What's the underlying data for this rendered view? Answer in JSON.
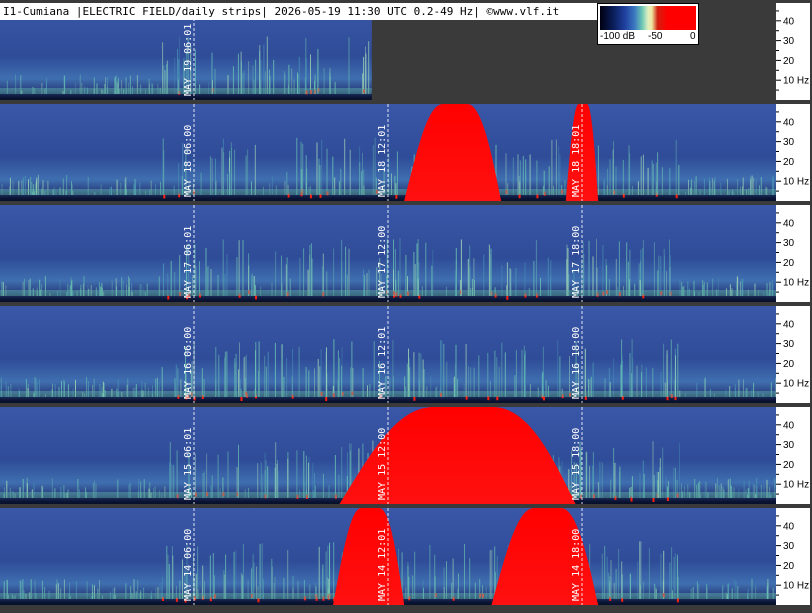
{
  "header": {
    "title": "I1-Cumiana |ELECTRIC FIELD/daily strips| 2026-05-19 11:30 UTC 0.2-49 Hz| ©www.vlf.it"
  },
  "colorbar": {
    "min_label": "-100 dB",
    "mid_label": "-50",
    "max_label": "0",
    "colors": [
      "#000010",
      "#0a1e5a",
      "#2040a0",
      "#3c78c0",
      "#6ec8b4",
      "#e0f0c0",
      "#d02010",
      "#ff0000"
    ]
  },
  "colors": {
    "background": "#3a3a3a",
    "spectrogram_base": "#2a3f8f",
    "band_low": "#6ec8b4",
    "saturation": "#ff0000",
    "axis_panel": "#ffffff"
  },
  "chart_data": {
    "type": "heatmap",
    "title": "I1-Cumiana |ELECTRIC FIELD/daily strips| 2026-05-19 11:30 UTC 0.2-49 Hz| ©www.vlf.it",
    "xlabel": "",
    "ylabel": "",
    "ylim": [
      0,
      49
    ],
    "yticks": [
      10,
      20,
      30,
      40
    ],
    "ytick_labels": [
      "10 Hz",
      "20",
      "30",
      "40"
    ],
    "strips": [
      {
        "day": "MAY 19",
        "complete": false,
        "end_time": "11:30",
        "markers": [
          {
            "label": "MAY 19 06:01",
            "hour": 6.0
          }
        ],
        "saturation_hours": []
      },
      {
        "day": "MAY 18",
        "complete": true,
        "markers": [
          {
            "label": "MAY 18 06:00",
            "hour": 6.0
          },
          {
            "label": "MAY 18 12:01",
            "hour": 12.0
          },
          {
            "label": "MAY 18 18:01",
            "hour": 18.0
          }
        ],
        "saturation_hours": [
          [
            12.5,
            15.5
          ],
          [
            17.5,
            18.5
          ]
        ]
      },
      {
        "day": "MAY 17",
        "complete": true,
        "markers": [
          {
            "label": "MAY 17 06:01",
            "hour": 6.0
          },
          {
            "label": "MAY 17 12:00",
            "hour": 12.0
          },
          {
            "label": "MAY 17 18:00",
            "hour": 18.0
          }
        ],
        "saturation_hours": []
      },
      {
        "day": "MAY 16",
        "complete": true,
        "markers": [
          {
            "label": "MAY 16 06:00",
            "hour": 6.0
          },
          {
            "label": "MAY 16 12:01",
            "hour": 12.0
          },
          {
            "label": "MAY 16 18:00",
            "hour": 18.0
          }
        ],
        "saturation_hours": []
      },
      {
        "day": "MAY 15",
        "complete": true,
        "markers": [
          {
            "label": "MAY 15 06:01",
            "hour": 6.0
          },
          {
            "label": "MAY 15 12:00",
            "hour": 12.0
          },
          {
            "label": "MAY 15 18:00",
            "hour": 18.0
          }
        ],
        "saturation_hours": [
          [
            10.5,
            17.8
          ]
        ]
      },
      {
        "day": "MAY 14",
        "complete": true,
        "markers": [
          {
            "label": "MAY 14 06:00",
            "hour": 6.0
          },
          {
            "label": "MAY 14 12:01",
            "hour": 12.0
          },
          {
            "label": "MAY 14 18:00",
            "hour": 18.0
          }
        ],
        "saturation_hours": [
          [
            10.3,
            12.5
          ],
          [
            15.2,
            18.5
          ]
        ]
      }
    ]
  }
}
